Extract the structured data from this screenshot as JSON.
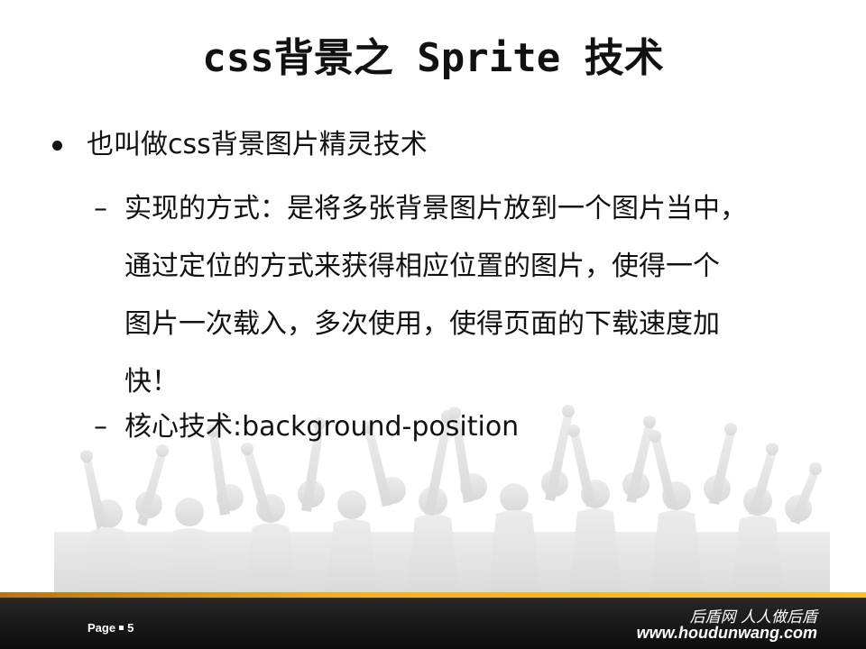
{
  "slide": {
    "title": "css背景之 Sprite 技术",
    "bullet": "也叫做css背景图片精灵技术",
    "sub_bullets": [
      {
        "dash": "–",
        "lines": [
          "实现的方式：是将多张背景图片放到一个图片当中，",
          "通过定位的方式来获得相应位置的图片，使得一个",
          "图片一次载入，多次使用，使得页面的下载速度加",
          "快！"
        ]
      },
      {
        "dash": "–",
        "lines": [
          "核心技术:background-position"
        ]
      }
    ]
  },
  "footer": {
    "page_label": "Page",
    "page_number": "5",
    "brand_cn": "后盾网 人人做后盾",
    "brand_url": "www.houdunwang.com"
  },
  "colors": {
    "text": "#111111",
    "footer_bg": "#1a1a1a",
    "accent": "#f2b50f",
    "crowd": "#e6e6e6"
  },
  "icons": {
    "bullet": "bullet-dot-icon",
    "background": "crowd-silhouette-icon"
  }
}
